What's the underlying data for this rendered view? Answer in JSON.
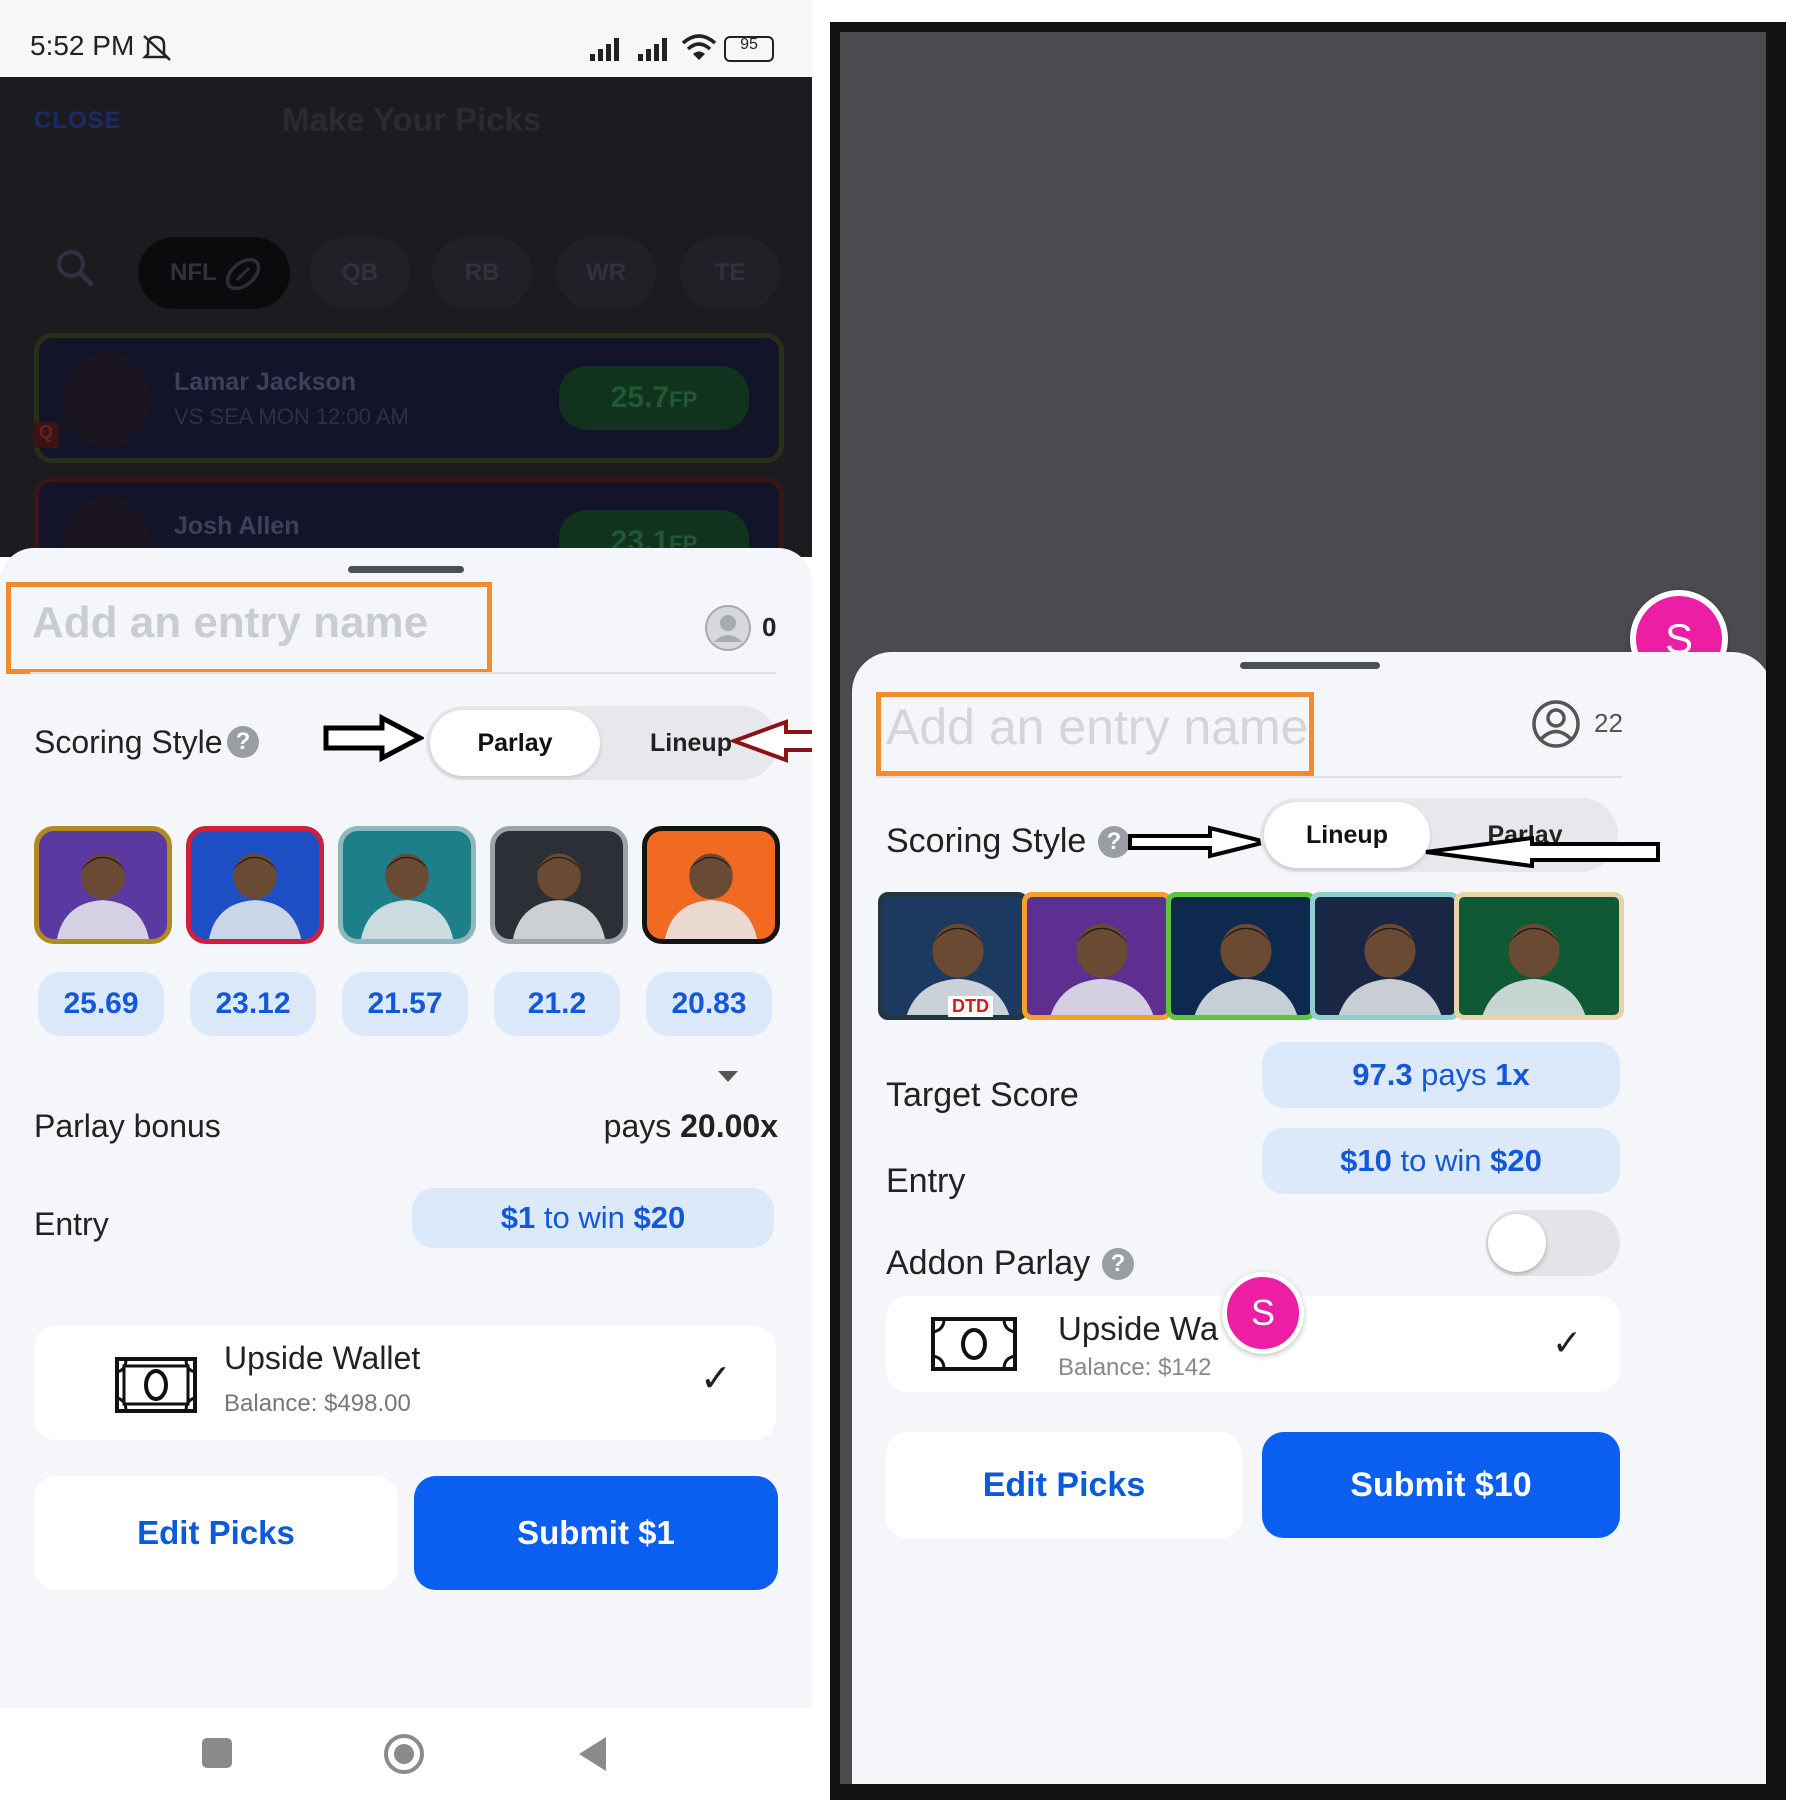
{
  "left": {
    "status": {
      "time": "5:52 PM",
      "battery": "95"
    },
    "header": {
      "close": "CLOSE",
      "title": "Make Your Picks"
    },
    "filters": {
      "chips": [
        "NFL",
        "QB",
        "RB",
        "WR",
        "TE"
      ]
    },
    "background_rows": [
      {
        "name": "Lamar Jackson",
        "sub": "VS SEA MON 12:00 AM",
        "fp": "25.7",
        "fp_unit": "FP",
        "tag": "Q"
      },
      {
        "name": "Josh Allen",
        "fp": "23.1",
        "fp_unit": "FP"
      }
    ],
    "sheet": {
      "entry_placeholder": "Add an entry name",
      "entrants": "0",
      "scoring_label": "Scoring Style",
      "help": "?",
      "seg_active": "Parlay",
      "seg_inactive": "Lineup",
      "players": [
        {
          "value": "25.69",
          "border": "#b08a24",
          "bg": "#5a3aa0"
        },
        {
          "value": "23.12",
          "border": "#d01f3d",
          "bg": "#1f4fc4"
        },
        {
          "value": "21.57",
          "border": "#8fb7be",
          "bg": "#1d8088"
        },
        {
          "value": "21.2",
          "border": "#9ea3aa",
          "bg": "#2c2f35"
        },
        {
          "value": "20.83",
          "border": "#141414",
          "bg": "#f26a22"
        }
      ],
      "parlay_bonus_label": "Parlay bonus",
      "pays_prefix": "pays ",
      "pays_value": "20.00x",
      "entry_label": "Entry",
      "entry_amount": "$1",
      "entry_mid": " to win ",
      "entry_win": "$20",
      "wallet_name": "Upside Wallet",
      "wallet_balance": "Balance: $498.00",
      "check": "✓",
      "edit_button": "Edit Picks",
      "submit_button": "Submit $1"
    }
  },
  "right": {
    "badge_letter": "S",
    "sheet": {
      "entry_placeholder": "Add an entry name",
      "entrants": "22",
      "scoring_label": "Scoring Style",
      "help": "?",
      "seg_active": "Lineup",
      "seg_inactive": "Parlay",
      "dtd_tag": "DTD",
      "players": [
        {
          "border": "#23353f",
          "bg": "#1c3a5f"
        },
        {
          "border": "#f4a12b",
          "bg": "#5d2f91"
        },
        {
          "border": "#5fc53a",
          "bg": "#0d2a4e"
        },
        {
          "border": "#8fd0cf",
          "bg": "#1a2744"
        },
        {
          "border": "#e8d3a6",
          "bg": "#0f5a35"
        }
      ],
      "target_label": "Target Score",
      "target_value": "97.3",
      "target_mid": " pays ",
      "target_mult": "1x",
      "entry_label": "Entry",
      "entry_amount": "$10",
      "entry_mid": " to win ",
      "entry_win": "$20",
      "addon_label": "Addon Parlay",
      "addon_on": false,
      "wallet_name": "Upside Wa",
      "wallet_balance": "Balance: $142",
      "check": "✓",
      "edit_button": "Edit Picks",
      "submit_button": "Submit $10"
    }
  },
  "colors": {
    "accent": "#0a5ef0",
    "annotation": "#f28a2e",
    "pill_bg": "#dce9fb",
    "badge": "#ec1ea4"
  },
  "icons": [
    "mute-icon",
    "signal-icon",
    "wifi-icon",
    "battery-icon",
    "search-icon",
    "football-icon",
    "person-icon",
    "help-icon",
    "cash-icon",
    "check-icon",
    "chevron-down-icon",
    "square-nav-icon",
    "home-nav-icon",
    "back-nav-icon",
    "arrow-right-icon",
    "arrow-left-icon"
  ]
}
